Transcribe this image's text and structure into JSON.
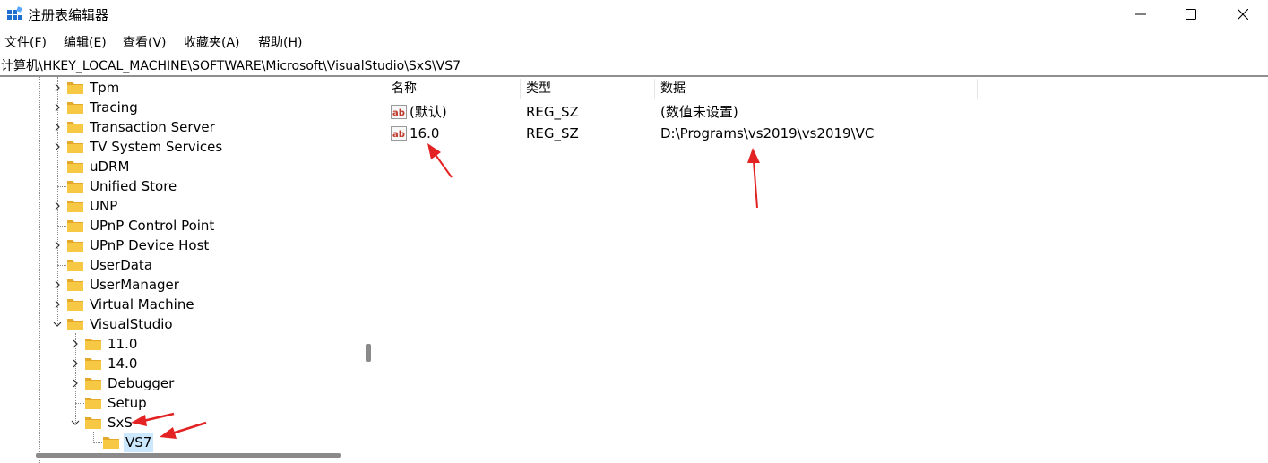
{
  "window": {
    "title": "注册表编辑器",
    "minimize_glyph": "—",
    "maximize_glyph": "☐",
    "close_glyph": "✕"
  },
  "menu": [
    "文件(F)",
    "编辑(E)",
    "查看(V)",
    "收藏夹(A)",
    "帮助(H)"
  ],
  "address": "计算机\\HKEY_LOCAL_MACHINE\\SOFTWARE\\Microsoft\\VisualStudio\\SxS\\VS7",
  "tree": [
    {
      "label": "Tpm",
      "expander": "collapsed"
    },
    {
      "label": "Tracing",
      "expander": "collapsed"
    },
    {
      "label": "Transaction Server",
      "expander": "collapsed"
    },
    {
      "label": "TV System Services",
      "expander": "collapsed"
    },
    {
      "label": "uDRM",
      "expander": "none"
    },
    {
      "label": "Unified Store",
      "expander": "none"
    },
    {
      "label": "UNP",
      "expander": "collapsed"
    },
    {
      "label": "UPnP Control Point",
      "expander": "none"
    },
    {
      "label": "UPnP Device Host",
      "expander": "collapsed"
    },
    {
      "label": "UserData",
      "expander": "none"
    },
    {
      "label": "UserManager",
      "expander": "collapsed"
    },
    {
      "label": "Virtual Machine",
      "expander": "collapsed"
    },
    {
      "label": "VisualStudio",
      "expander": "expanded"
    },
    {
      "label": "11.0",
      "expander": "collapsed"
    },
    {
      "label": "14.0",
      "expander": "collapsed"
    },
    {
      "label": "Debugger",
      "expander": "collapsed"
    },
    {
      "label": "Setup",
      "expander": "none"
    },
    {
      "label": "SxS",
      "expander": "expanded"
    },
    {
      "label": "VS7",
      "expander": "none",
      "selected": true
    }
  ],
  "list": {
    "columns": [
      "名称",
      "类型",
      "数据"
    ],
    "rows": [
      {
        "name": "(默认)",
        "type": "REG_SZ",
        "data": "(数值未设置)",
        "icon": "string-value-icon"
      },
      {
        "name": "16.0",
        "type": "REG_SZ",
        "data": "D:\\Programs\\vs2019\\vs2019\\VC",
        "icon": "string-value-icon"
      }
    ]
  },
  "colors": {
    "folder": "#f6c844",
    "folder_dark": "#e4a92a",
    "selection": "#cce8ff",
    "annotation_arrow": "#e32323",
    "icon_blue": "#1f6fd1"
  }
}
